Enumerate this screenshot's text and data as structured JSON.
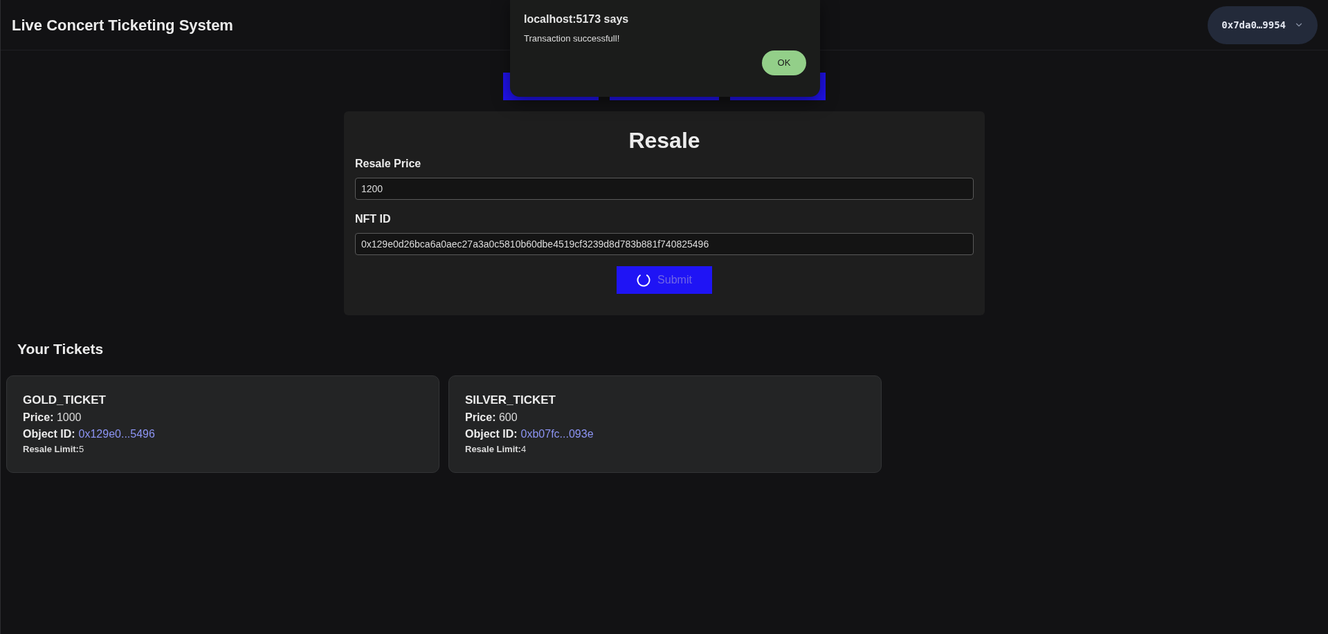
{
  "header": {
    "title": "Live Concert Ticketing System",
    "wallet": {
      "address": "0x7da0…9954"
    }
  },
  "dialog": {
    "title": "localhost:5173 says",
    "message": "Transaction successfull!",
    "button": "OK"
  },
  "form": {
    "title": "Resale",
    "fields": [
      {
        "label": "Resale Price",
        "value": "1200"
      },
      {
        "label": "NFT ID",
        "value": "0x129e0d26bca6a0aec27a3a0c5810b60dbe4519cf3239d8d783b881f740825496"
      }
    ],
    "submit": {
      "label": "Submit",
      "loading": true
    }
  },
  "tickets": {
    "heading": "Your Tickets",
    "items": [
      {
        "name": "GOLD_TICKET",
        "price": "**Price:** 1000",
        "object_id_label": "Object ID:",
        "object_id": "0x129e0...5496",
        "resale_limit": "**Resale Limit:**5"
      },
      {
        "name": "SILVER_TICKET",
        "price": "**Price:** 600",
        "object_id_label": "Object ID:",
        "object_id": "0xb07fc...093e",
        "resale_limit": "**Resale Limit:**4"
      }
    ]
  }
}
